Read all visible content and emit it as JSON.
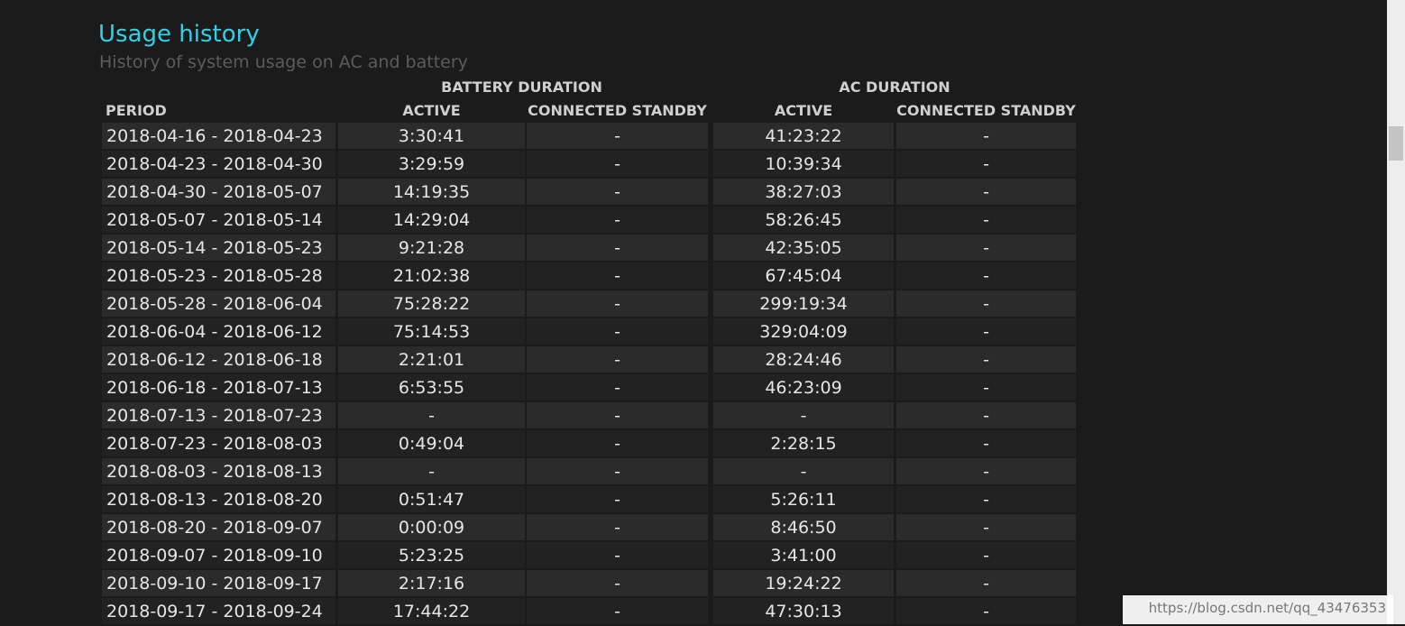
{
  "title": "Usage history",
  "subtitle": "History of system usage on AC and battery",
  "groups": {
    "battery": "BATTERY DURATION",
    "ac": "AC DURATION"
  },
  "columns": {
    "period": "PERIOD",
    "bat_active": "ACTIVE",
    "bat_standby": "CONNECTED STANDBY",
    "ac_active": "ACTIVE",
    "ac_standby": "CONNECTED STANDBY"
  },
  "rows": [
    {
      "period": "2018-04-16 - 2018-04-23",
      "bat_active": "3:30:41",
      "bat_standby": "-",
      "ac_active": "41:23:22",
      "ac_standby": "-"
    },
    {
      "period": "2018-04-23 - 2018-04-30",
      "bat_active": "3:29:59",
      "bat_standby": "-",
      "ac_active": "10:39:34",
      "ac_standby": "-"
    },
    {
      "period": "2018-04-30 - 2018-05-07",
      "bat_active": "14:19:35",
      "bat_standby": "-",
      "ac_active": "38:27:03",
      "ac_standby": "-"
    },
    {
      "period": "2018-05-07 - 2018-05-14",
      "bat_active": "14:29:04",
      "bat_standby": "-",
      "ac_active": "58:26:45",
      "ac_standby": "-"
    },
    {
      "period": "2018-05-14 - 2018-05-23",
      "bat_active": "9:21:28",
      "bat_standby": "-",
      "ac_active": "42:35:05",
      "ac_standby": "-"
    },
    {
      "period": "2018-05-23 - 2018-05-28",
      "bat_active": "21:02:38",
      "bat_standby": "-",
      "ac_active": "67:45:04",
      "ac_standby": "-"
    },
    {
      "period": "2018-05-28 - 2018-06-04",
      "bat_active": "75:28:22",
      "bat_standby": "-",
      "ac_active": "299:19:34",
      "ac_standby": "-"
    },
    {
      "period": "2018-06-04 - 2018-06-12",
      "bat_active": "75:14:53",
      "bat_standby": "-",
      "ac_active": "329:04:09",
      "ac_standby": "-"
    },
    {
      "period": "2018-06-12 - 2018-06-18",
      "bat_active": "2:21:01",
      "bat_standby": "-",
      "ac_active": "28:24:46",
      "ac_standby": "-"
    },
    {
      "period": "2018-06-18 - 2018-07-13",
      "bat_active": "6:53:55",
      "bat_standby": "-",
      "ac_active": "46:23:09",
      "ac_standby": "-"
    },
    {
      "period": "2018-07-13 - 2018-07-23",
      "bat_active": "-",
      "bat_standby": "-",
      "ac_active": "-",
      "ac_standby": "-"
    },
    {
      "period": "2018-07-23 - 2018-08-03",
      "bat_active": "0:49:04",
      "bat_standby": "-",
      "ac_active": "2:28:15",
      "ac_standby": "-"
    },
    {
      "period": "2018-08-03 - 2018-08-13",
      "bat_active": "-",
      "bat_standby": "-",
      "ac_active": "-",
      "ac_standby": "-"
    },
    {
      "period": "2018-08-13 - 2018-08-20",
      "bat_active": "0:51:47",
      "bat_standby": "-",
      "ac_active": "5:26:11",
      "ac_standby": "-"
    },
    {
      "period": "2018-08-20 - 2018-09-07",
      "bat_active": "0:00:09",
      "bat_standby": "-",
      "ac_active": "8:46:50",
      "ac_standby": "-"
    },
    {
      "period": "2018-09-07 - 2018-09-10",
      "bat_active": "5:23:25",
      "bat_standby": "-",
      "ac_active": "3:41:00",
      "ac_standby": "-"
    },
    {
      "period": "2018-09-10 - 2018-09-17",
      "bat_active": "2:17:16",
      "bat_standby": "-",
      "ac_active": "19:24:22",
      "ac_standby": "-"
    },
    {
      "period": "2018-09-17 - 2018-09-24",
      "bat_active": "17:44:22",
      "bat_standby": "-",
      "ac_active": "47:30:13",
      "ac_standby": "-"
    }
  ],
  "watermark": "https://blog.csdn.net/qq_43476353",
  "colors": {
    "title": "#2ed2e8",
    "background": "#1b1b1b"
  }
}
